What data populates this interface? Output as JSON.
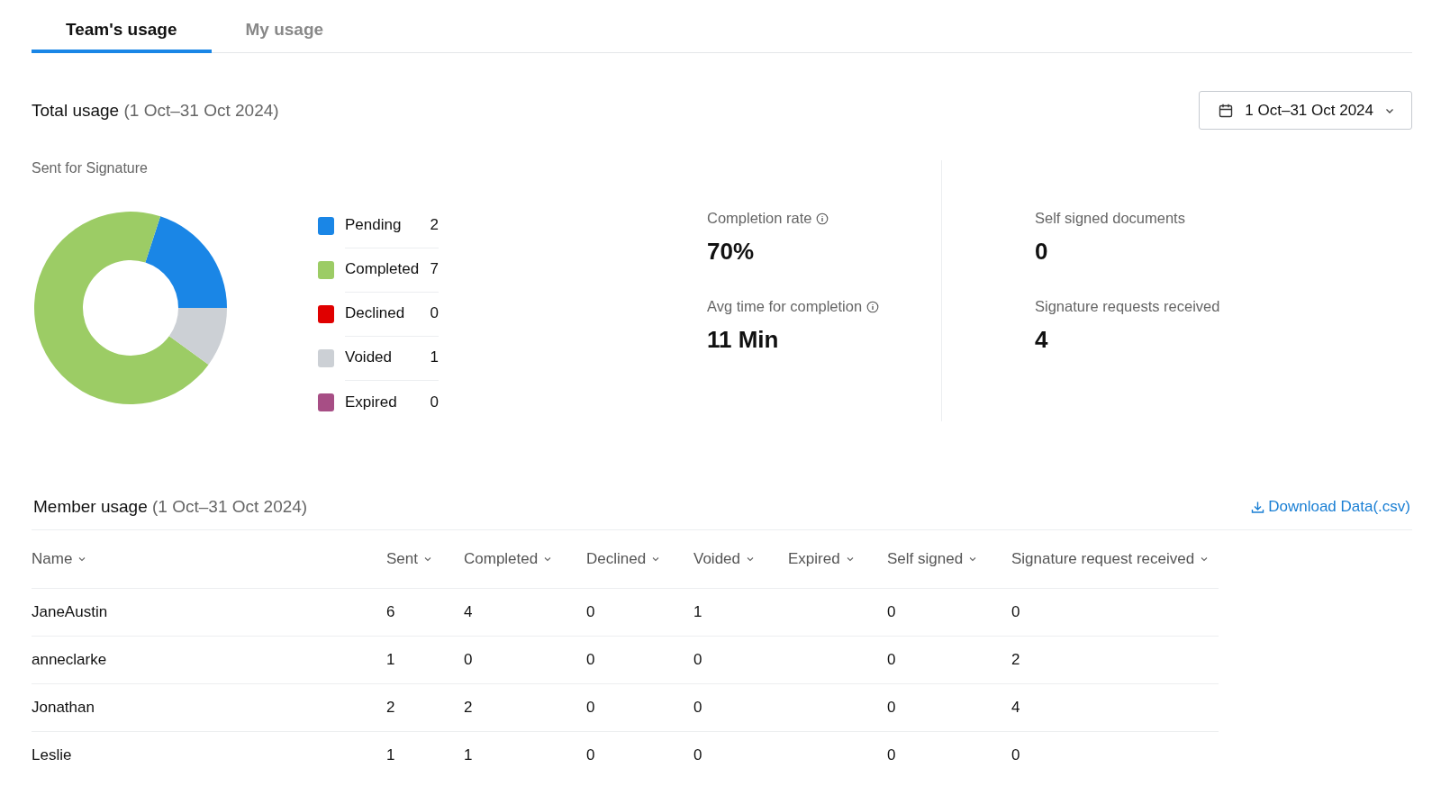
{
  "tabs": [
    {
      "label": "Team's usage",
      "selected": true
    },
    {
      "label": "My usage",
      "selected": false
    }
  ],
  "total_usage": {
    "title": "Total usage",
    "period": "(1 Oct–31 Oct 2024)",
    "date_picker": "1 Oct–31 Oct 2024"
  },
  "sent_for_signature": {
    "title": "Sent for Signature",
    "chart_data": {
      "type": "donut",
      "categories": [
        "Pending",
        "Completed",
        "Declined",
        "Voided",
        "Expired"
      ],
      "values": [
        20,
        70,
        0,
        10,
        0
      ]
    },
    "legend": [
      {
        "color": "#1a86e6",
        "count": "2"
      },
      {
        "color": "#9ccc65",
        "count": "7"
      },
      {
        "color": "#e00000",
        "count": "0"
      },
      {
        "color": "#ccd0d5",
        "count": "1"
      },
      {
        "color": "#a74e85",
        "count": "0"
      }
    ]
  },
  "stats": [
    {
      "label": "Completion rate",
      "value": "70%",
      "kind": "info"
    },
    {
      "label": "Avg time for completion",
      "value": "11 Min",
      "kind": "info"
    },
    {
      "label": "Self signed documents",
      "value": "0",
      "kind": "plain"
    },
    {
      "label": "Signature requests received",
      "value": "4",
      "kind": "plain"
    }
  ],
  "member_usage": {
    "title": "Member usage",
    "period": "(1 Oct–31 Oct 2024)",
    "download": "Download Data(.csv)",
    "columns": [
      "Name",
      "Sent",
      "Completed",
      "Declined",
      "Voided",
      "Expired",
      "Self signed",
      "Signature request received"
    ],
    "rows": [
      {
        "name": "JaneAustin",
        "sent": "6",
        "completed": "4",
        "declined": "0",
        "voided": "1",
        "self_signed": "0",
        "signature_request_received": "0"
      },
      {
        "name": "anneclarke",
        "sent": "1",
        "completed": "0",
        "declined": "0",
        "voided": "0",
        "self_signed": "0",
        "signature_request_received": "2"
      },
      {
        "name": "Jonathan",
        "sent": "2",
        "completed": "2",
        "declined": "0",
        "voided": "0",
        "self_signed": "0",
        "signature_request_received": "4"
      },
      {
        "name": "Leslie",
        "sent": "1",
        "completed": "1",
        "declined": "0",
        "voided": "0",
        "self_signed": "0",
        "signature_request_received": "0"
      }
    ]
  }
}
